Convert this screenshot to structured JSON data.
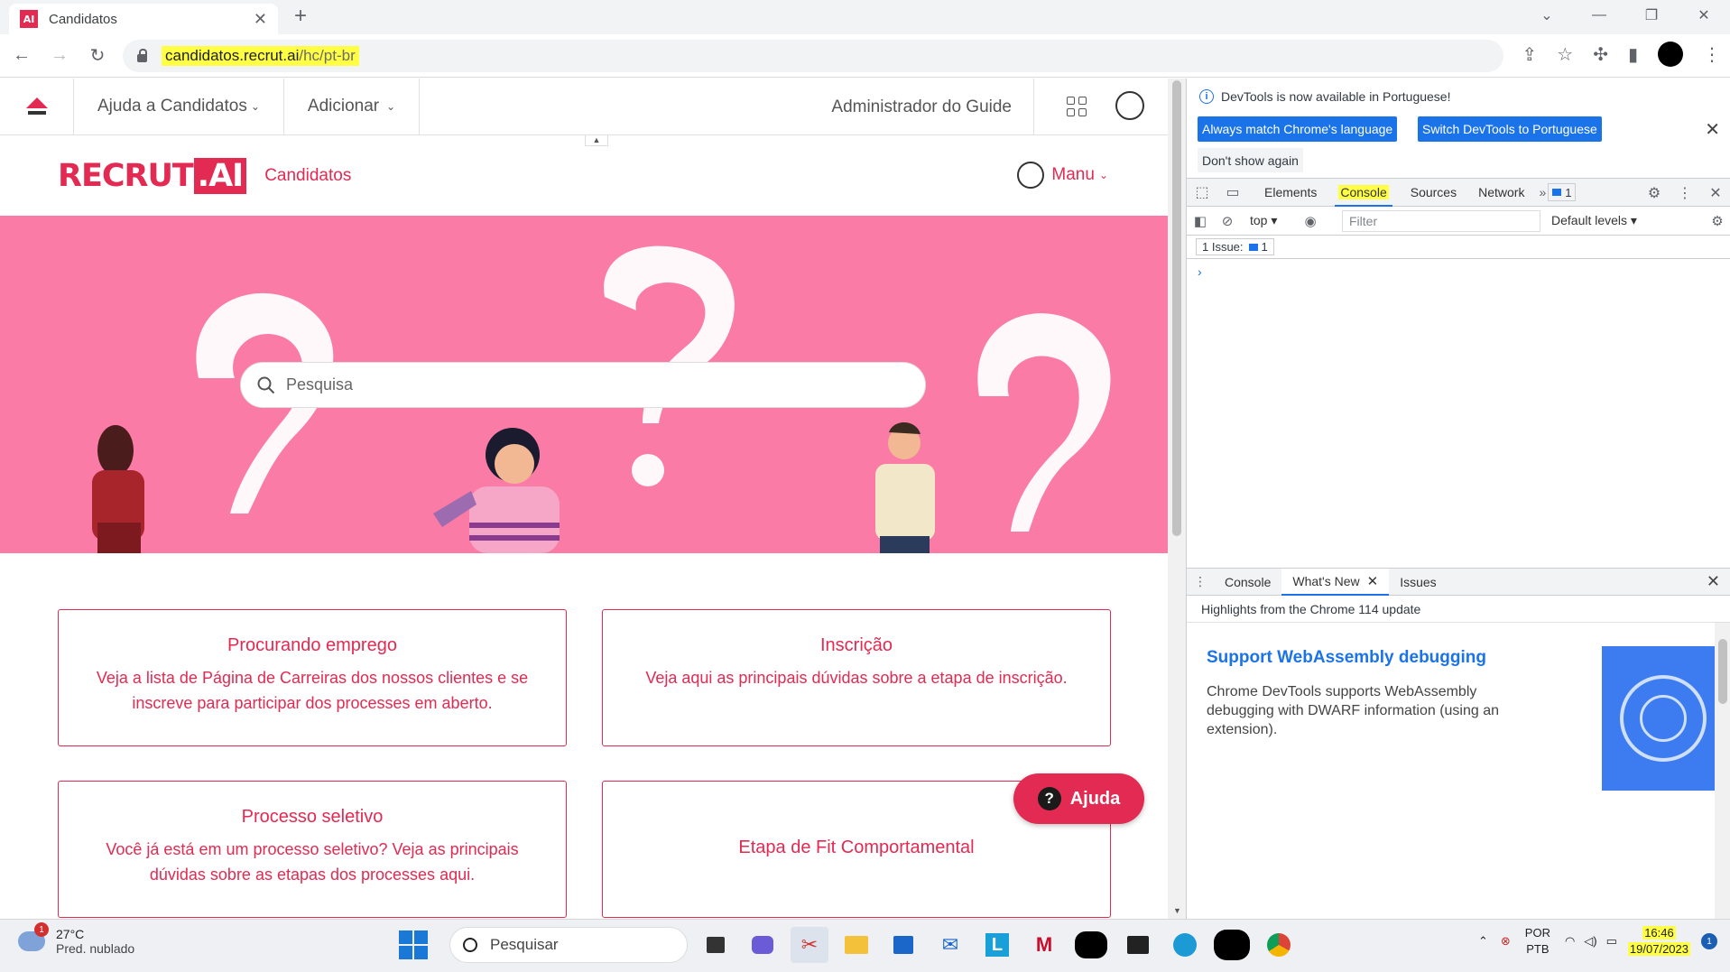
{
  "browser": {
    "tab_title": "Candidatos",
    "favicon_text": "AI",
    "url_host": "candidatos.recrut.ai",
    "url_path": "/hc/pt-br"
  },
  "guide_bar": {
    "items": [
      "Ajuda a Candidatos",
      "Adicionar"
    ],
    "admin": "Administrador do Guide"
  },
  "site": {
    "brand": "RECRUT",
    "brand_suffix": ".AI",
    "section": "Candidatos",
    "user": "Manu",
    "search_placeholder": "Pesquisa"
  },
  "cards": [
    {
      "title": "Procurando emprego",
      "desc": "Veja a lista de Página de Carreiras dos nossos clientes e se inscreve para participar dos processes em aberto."
    },
    {
      "title": "Inscrição",
      "desc": "Veja aqui as principais dúvidas sobre a etapa de inscrição."
    },
    {
      "title": "Processo seletivo",
      "desc": "Você já está em um processo seletivo? Veja as principais dúvidas sobre as etapas dos processes aqui."
    },
    {
      "title": "Etapa de Fit Comportamental",
      "desc": ""
    }
  ],
  "help_button": "Ajuda",
  "devtools": {
    "notice": "DevTools is now available in Portuguese!",
    "btn_match": "Always match Chrome's language",
    "btn_switch": "Switch DevTools to Portuguese",
    "btn_dismiss": "Don't show again",
    "tabs": [
      "Elements",
      "Console",
      "Sources",
      "Network"
    ],
    "active_tab": "Console",
    "badge_count": "1",
    "context": "top",
    "filter_placeholder": "Filter",
    "levels": "Default levels",
    "issues_label": "1 Issue:",
    "issues_count": "1",
    "prompt": "›",
    "drawer_tabs": [
      "Console",
      "What's New",
      "Issues"
    ],
    "highlights": "Highlights from the Chrome 114 update",
    "whatsnew_title": "Support WebAssembly debugging",
    "whatsnew_body": "Chrome DevTools supports WebAssembly debugging with DWARF information (using an extension)."
  },
  "taskbar": {
    "weather_temp": "27°C",
    "weather_desc": "Pred. nublado",
    "weather_badge": "1",
    "search_label": "Pesquisar",
    "lang_line1": "POR",
    "lang_line2": "PTB",
    "time": "16:46",
    "date": "19/07/2023",
    "notif_count": "1"
  },
  "colors": {
    "brand": "#e22a52",
    "hero_bg": "#fa7ba5",
    "devtools_blue": "#1a73e8"
  }
}
